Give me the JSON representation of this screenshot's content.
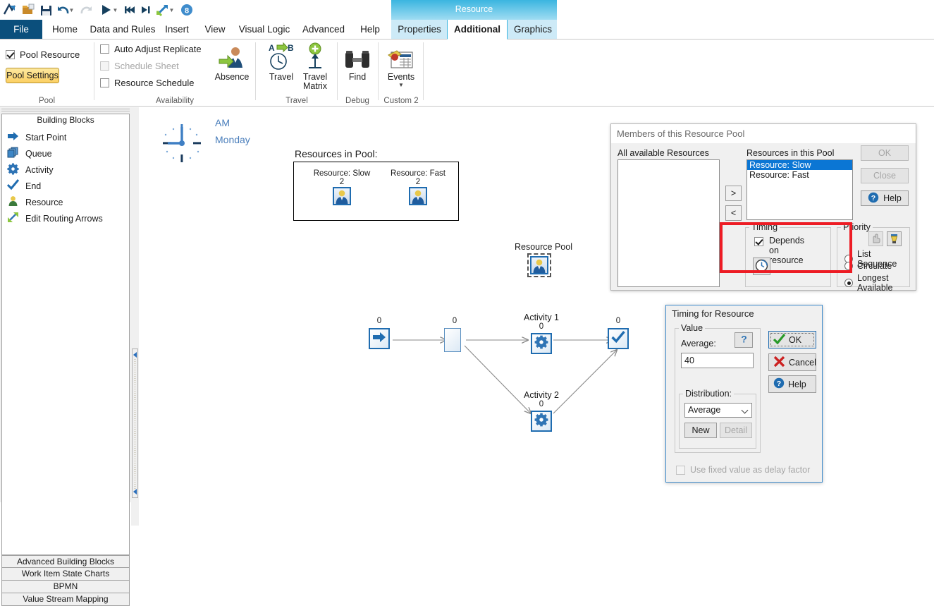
{
  "quick_access": {
    "items": [
      {
        "name": "app-logo-icon",
        "label": "Simul8"
      },
      {
        "name": "open-icon",
        "label": "Open"
      },
      {
        "name": "save-icon",
        "label": "Save"
      },
      {
        "name": "undo-icon",
        "label": "Undo"
      },
      {
        "name": "undo-dropdown-icon",
        "label": "Undo options"
      },
      {
        "name": "redo-icon",
        "label": "Redo"
      },
      {
        "name": "run-icon",
        "label": "Run"
      },
      {
        "name": "run-dropdown-icon",
        "label": "Run options"
      },
      {
        "name": "rewind-icon",
        "label": "Reset"
      },
      {
        "name": "step-icon",
        "label": "Step"
      },
      {
        "name": "results-icon",
        "label": "Results"
      },
      {
        "name": "results-dropdown-icon",
        "label": "Results options"
      },
      {
        "name": "trials-icon",
        "label": "8"
      }
    ],
    "badge_value": "8"
  },
  "ribbon": {
    "tabs": [
      {
        "label": "File"
      },
      {
        "label": "Home"
      },
      {
        "label": "Data and Rules"
      },
      {
        "label": "Insert"
      },
      {
        "label": "View"
      },
      {
        "label": "Visual Logic"
      },
      {
        "label": "Advanced"
      },
      {
        "label": "Help"
      }
    ],
    "contextual": {
      "title": "Resource",
      "tabs": [
        {
          "label": "Properties",
          "active": false
        },
        {
          "label": "Additional",
          "active": true
        },
        {
          "label": "Graphics",
          "active": false
        }
      ]
    },
    "groups": [
      {
        "name": "pool",
        "label": "Pool",
        "checkbox": {
          "label": "Pool Resource",
          "checked": true,
          "enabled": true
        },
        "button": {
          "label": "Pool Settings"
        }
      },
      {
        "name": "availability",
        "label": "Availability",
        "checkboxes": [
          {
            "label": "Auto Adjust Replicate",
            "checked": false,
            "enabled": true
          },
          {
            "label": "Schedule Sheet",
            "checked": false,
            "enabled": false
          },
          {
            "label": "Resource Schedule",
            "checked": false,
            "enabled": true
          }
        ],
        "buttons": [
          {
            "label": "Absence",
            "icon": "absence-icon"
          }
        ]
      },
      {
        "name": "travel",
        "label": "Travel",
        "buttons": [
          {
            "label": "Travel",
            "icon": "travel-icon"
          },
          {
            "label": "Travel Matrix",
            "icon": "travel-matrix-icon"
          }
        ]
      },
      {
        "name": "debug",
        "label": "Debug",
        "buttons": [
          {
            "label": "Find",
            "icon": "binoculars-icon"
          }
        ]
      },
      {
        "name": "custom2",
        "label": "Custom 2",
        "buttons": [
          {
            "label": "Events",
            "icon": "events-icon",
            "has_dropdown": true
          }
        ]
      }
    ]
  },
  "left_panel": {
    "title": "Building Blocks",
    "items": [
      {
        "label": "Start Point",
        "icon": "start-point-icon"
      },
      {
        "label": "Queue",
        "icon": "queue-icon"
      },
      {
        "label": "Activity",
        "icon": "activity-icon"
      },
      {
        "label": "End",
        "icon": "end-icon"
      },
      {
        "label": "Resource",
        "icon": "resource-icon"
      },
      {
        "label": "Edit Routing Arrows",
        "icon": "edit-routing-arrows-icon"
      }
    ],
    "bottom_tabs": [
      {
        "label": "Advanced Building Blocks"
      },
      {
        "label": "Work Item State Charts"
      },
      {
        "label": "BPMN"
      },
      {
        "label": "Value Stream Mapping"
      }
    ]
  },
  "canvas": {
    "clock": {
      "period": "AM",
      "day": "Monday"
    },
    "resources_in_pool": {
      "caption": "Resources in Pool:",
      "members": [
        {
          "name": "Resource: Slow",
          "count": "2"
        },
        {
          "name": "Resource: Fast",
          "count": "2"
        }
      ]
    },
    "resource_pool": {
      "label": "Resource Pool"
    },
    "flow": {
      "nodes": [
        {
          "id": "start",
          "label": "",
          "count": "0",
          "icon": "start-point-icon"
        },
        {
          "id": "queue",
          "label": "",
          "count": "0",
          "icon": "queue-icon"
        },
        {
          "id": "activity1",
          "label": "Activity 1",
          "count": "0",
          "icon": "activity-icon"
        },
        {
          "id": "activity2",
          "label": "Activity 2",
          "count": "0",
          "icon": "activity-icon"
        },
        {
          "id": "end",
          "label": "",
          "count": "0",
          "icon": "end-icon"
        }
      ]
    }
  },
  "members_dialog": {
    "title": "Members of this Resource Pool",
    "available_label": "All available Resources",
    "available_items": [],
    "in_pool_label": "Resources in this Pool",
    "in_pool_items": [
      {
        "label": "Resource: Slow",
        "selected": true
      },
      {
        "label": "Resource: Fast",
        "selected": false
      }
    ],
    "move_right_label": ">",
    "move_left_label": "<",
    "ok_label": "OK",
    "close_label": "Close",
    "help_label": "Help",
    "timing": {
      "caption": "Timing",
      "checkbox_label": "Depends on resource",
      "checkbox_checked": true,
      "clock_button_icon": "clock-icon",
      "highlight_color": "#ed1c24"
    },
    "priority": {
      "caption": "Priority",
      "icon_buttons": [
        {
          "name": "hand-priority-icon",
          "enabled": false
        },
        {
          "name": "stamp-priority-icon",
          "enabled": true
        }
      ],
      "options": [
        {
          "label": "List Sequence",
          "selected": false
        },
        {
          "label": "Circulate",
          "selected": false
        },
        {
          "label": "Longest Available",
          "selected": true
        }
      ]
    }
  },
  "timing_dialog": {
    "title": "Timing for Resource",
    "value_caption": "Value",
    "average_label": "Average:",
    "average_value": "40",
    "help_hint_icon": "question-icon",
    "distribution_caption": "Distribution:",
    "distribution_value": "Average",
    "new_label": "New",
    "detail_label": "Detail",
    "fixed_value_label": "Use fixed value as delay factor",
    "fixed_value_checked": false,
    "ok_label": "OK",
    "cancel_label": "Cancel",
    "help_label": "Help"
  }
}
